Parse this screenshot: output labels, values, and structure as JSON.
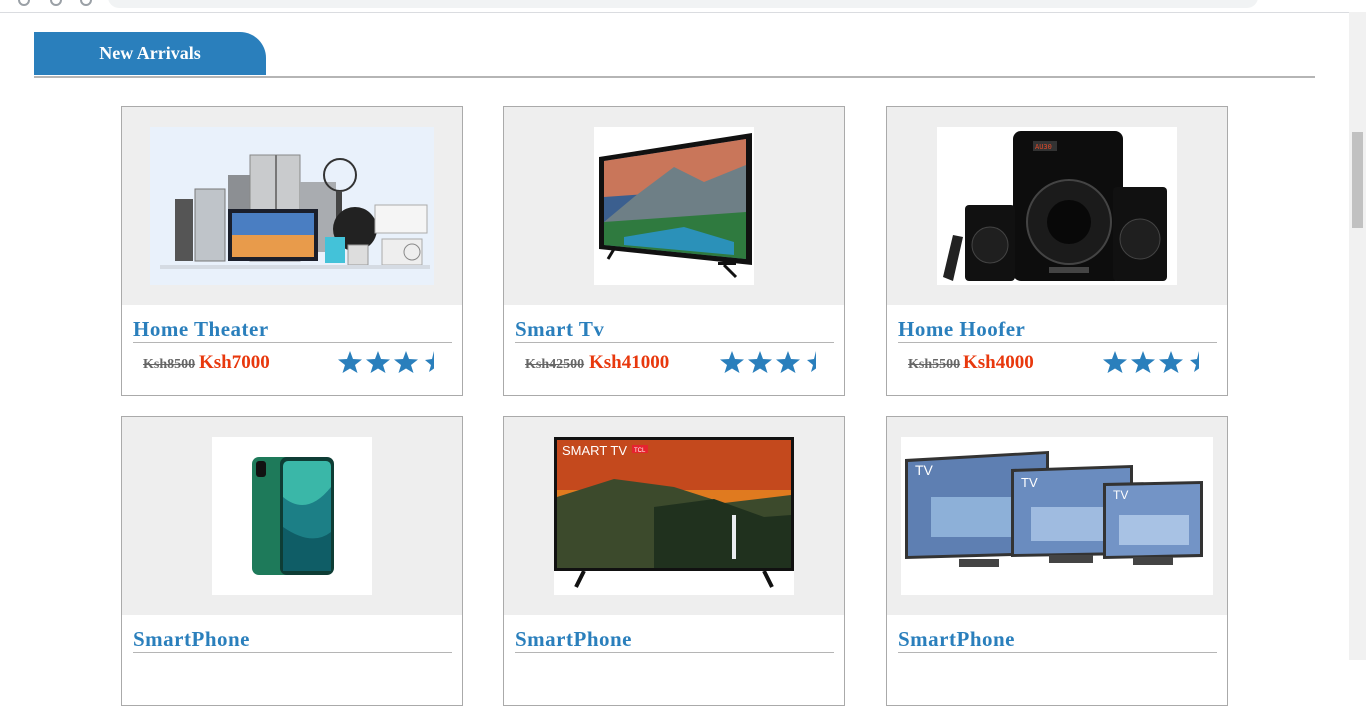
{
  "section": {
    "title": "New Arrivals"
  },
  "products": [
    {
      "name": "Home Theater",
      "old_price": "Ksh8500",
      "new_price": "Ksh7000",
      "rating": 3.5,
      "image_icon": "appliances-image"
    },
    {
      "name": "Smart Tv",
      "old_price": "Ksh42500",
      "new_price": "Ksh41000",
      "rating": 3.5,
      "image_icon": "tv-image"
    },
    {
      "name": "Home Hoofer",
      "old_price": "Ksh5500",
      "new_price": "Ksh4000",
      "rating": 3.5,
      "image_icon": "speaker-image"
    },
    {
      "name": "SmartPhone",
      "image_icon": "phone-image"
    },
    {
      "name": "SmartPhone",
      "image_icon": "tv-image",
      "image_text": {
        "smart_tv": "SMART TV",
        "badge": "TCL"
      }
    },
    {
      "name": "SmartPhone",
      "image_icon": "tv-set-image",
      "image_text": {
        "tv_label": "TV"
      }
    }
  ],
  "colors": {
    "accent": "#2a7fbc",
    "price": "#e8380d",
    "star": "#2a7fbc",
    "card_bg": "#eeeeee"
  }
}
